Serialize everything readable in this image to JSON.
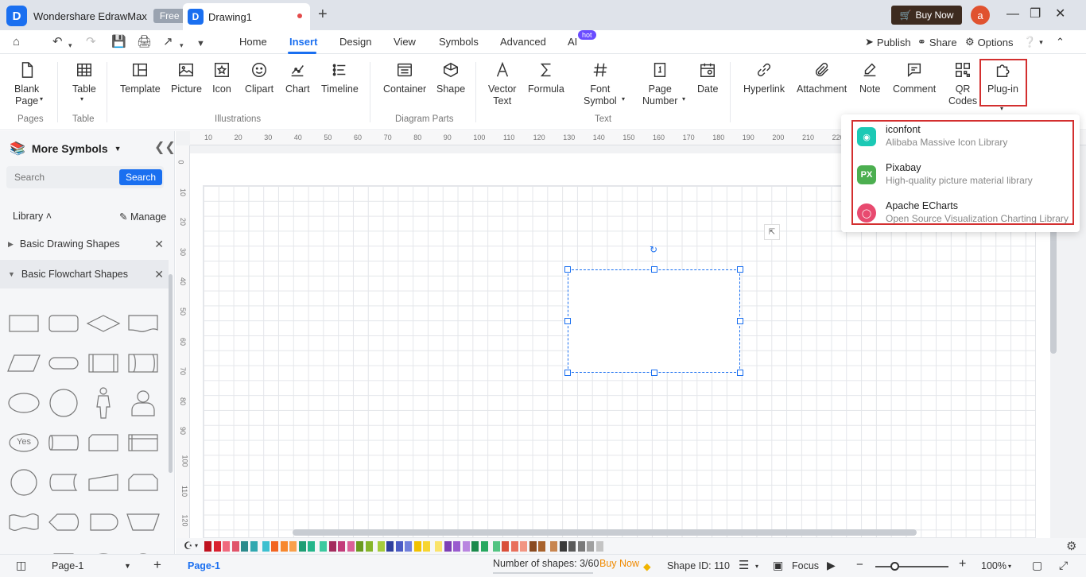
{
  "titlebar": {
    "app_name": "Wondershare EdrawMax",
    "free_badge": "Free",
    "doc_tab": "Drawing1",
    "buy_now": "Buy Now",
    "avatar_letter": "a"
  },
  "menubar": {
    "items": [
      "Home",
      "Insert",
      "Design",
      "View",
      "Symbols",
      "Advanced",
      "AI"
    ],
    "active": "Insert",
    "hot_badge": "hot",
    "publish": "Publish",
    "share": "Share",
    "options": "Options"
  },
  "ribbon": {
    "blank_page": "Blank\nPage",
    "table": "Table",
    "template": "Template",
    "picture": "Picture",
    "icon": "Icon",
    "clipart": "Clipart",
    "chart": "Chart",
    "timeline": "Timeline",
    "container": "Container",
    "shape": "Shape",
    "vector_text": "Vector\nText",
    "formula": "Formula",
    "font_symbol": "Font\nSymbol",
    "page_number": "Page\nNumber",
    "date": "Date",
    "hyperlink": "Hyperlink",
    "attachment": "Attachment",
    "note": "Note",
    "comment": "Comment",
    "qr_codes": "QR\nCodes",
    "plugin": "Plug-in",
    "groups": {
      "pages": "Pages",
      "table": "Table",
      "illustrations": "Illustrations",
      "diagram_parts": "Diagram Parts",
      "text": "Text"
    }
  },
  "left_panel": {
    "title": "More Symbols",
    "search_placeholder": "Search",
    "search_button": "Search",
    "library_label": "Library",
    "manage_label": "Manage",
    "libraries": [
      {
        "label": "Basic Drawing Shapes",
        "expanded": false
      },
      {
        "label": "Basic Flowchart Shapes",
        "expanded": true
      }
    ],
    "yes_label": "Yes"
  },
  "ruler": {
    "top": [
      "10",
      "20",
      "30",
      "40",
      "50",
      "60",
      "70",
      "80",
      "90",
      "100",
      "110",
      "120",
      "130",
      "140",
      "150",
      "160",
      "170",
      "180",
      "190",
      "200",
      "210",
      "220"
    ],
    "left": [
      "0",
      "10",
      "20",
      "30",
      "40",
      "50",
      "60",
      "70",
      "80",
      "90",
      "100",
      "110",
      "120"
    ]
  },
  "plugin_menu": {
    "items": [
      {
        "name": "iconfont",
        "desc": "Alibaba Massive Icon Library",
        "color": "#1cc9b5"
      },
      {
        "name": "Pixabay",
        "desc": "High-quality picture material library",
        "color": "#4caf50"
      },
      {
        "name": "Apache ECharts",
        "desc": "Open Source Visualization Charting Library",
        "color": "#e84a6f"
      }
    ]
  },
  "status_bar": {
    "page_select": "Page-1",
    "page_tab": "Page-1",
    "shape_count": "Number of shapes: 3/60",
    "buy_now": "Buy Now",
    "shape_id": "Shape ID: 110",
    "focus": "Focus",
    "zoom": "100%"
  },
  "colors": {
    "accent": "#1a6ff0",
    "highlight": "#d32f2f",
    "palette": [
      "#c0121f",
      "#d9202f",
      "#f06a7e",
      "#e0546a",
      "#2b8a8c",
      "#30a8b0",
      "#3cc0d0",
      "#f26522",
      "#f7882f",
      "#f9a04b",
      "#1d9e74",
      "#23b58a",
      "#3cc9a0",
      "#a32c5e",
      "#c23b7a",
      "#da5f98",
      "#6a9a1f",
      "#86b52a",
      "#a5cc3c",
      "#2e3f9e",
      "#4a5bc4",
      "#7180dc",
      "#f2c200",
      "#f7d531",
      "#fae36a",
      "#7d3fb5",
      "#9a5ccf",
      "#b985e0",
      "#1b8a4c",
      "#27a860",
      "#52c482",
      "#d94f3a",
      "#e8705d",
      "#f29683",
      "#8a4b21",
      "#a8632d",
      "#c88650",
      "#3a3a3a",
      "#5a5a5a",
      "#7a7a7a",
      "#a0a0a0",
      "#c4c4c4"
    ]
  }
}
